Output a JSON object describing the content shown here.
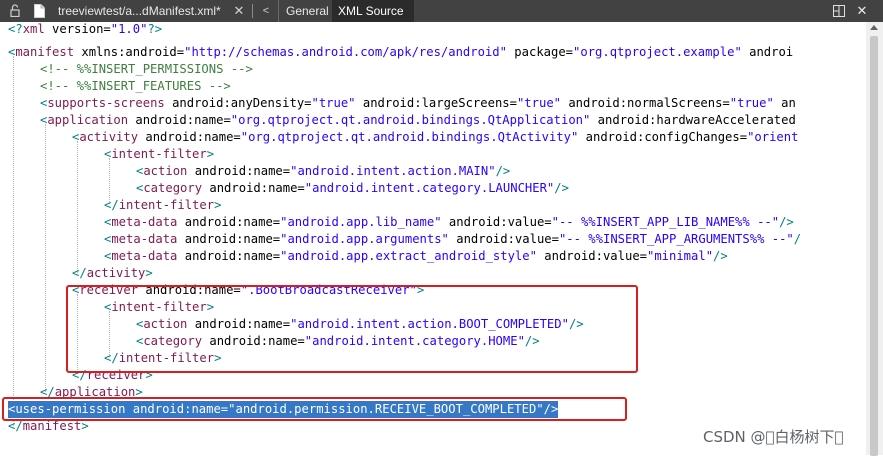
{
  "tabbar": {
    "file_tab": "treeviewtest/a...dManifest.xml*",
    "close_glyph": "✕",
    "nav_glyph": "<",
    "tabs": [
      "General",
      "XML Source"
    ],
    "active_tab": "XML Source",
    "close_editor_glyph": "✕",
    "icons": [
      "lock-icon",
      "file-icon",
      "split-editor-icon"
    ]
  },
  "colors": {
    "tabbar_bg": "#424242",
    "active_tab_bg": "#2b2b2b",
    "tag": "#7f1a4f",
    "bracket": "#008080",
    "value": "#2a00ff",
    "comment": "#3f7f3f",
    "selection": "#3478c6",
    "highlight_box": "#d81e1e"
  },
  "code": {
    "decl": {
      "open": "<?",
      "name": "xml",
      "attrs": " version=",
      "v": "\"1.0\"",
      "close": "?>"
    },
    "manifest": {
      "open": "<",
      "name": "manifest",
      "attrs": " xmlns:android=",
      "v1": "\"http://schemas.android.com/apk/res/android\"",
      "attrs2": " package=",
      "v2": "\"org.qtproject.example\"",
      "attrs3": " androi"
    },
    "comment_permissions": "<!-- %%INSERT_PERMISSIONS -->",
    "comment_features": "<!-- %%INSERT_FEATURES -->",
    "supports_screens": {
      "open": "<",
      "name": "supports-screens",
      "a1": " android:anyDensity=",
      "v1": "\"true\"",
      "a2": " android:largeScreens=",
      "v2": "\"true\"",
      "a3": " android:normalScreens=",
      "v3": "\"true\"",
      "a4": " an"
    },
    "application": {
      "open": "<",
      "name": "application",
      "a1": " android:name=",
      "v1": "\"org.qtproject.qt.android.bindings.QtApplication\"",
      "a2": " android:hardwareAccelerated"
    },
    "activity": {
      "open": "<",
      "name": "activity",
      "a1": " android:name=",
      "v1": "\"org.qtproject.qt.android.bindings.QtActivity\"",
      "a2": " android:configChanges=",
      "v2": "\"orient"
    },
    "intent_filter_open": {
      "open": "<",
      "name": "intent-filter",
      "close": ">"
    },
    "action_main": {
      "open": "<",
      "name": "action",
      "a1": " android:name=",
      "v1": "\"android.intent.action.MAIN\"",
      "close": "/>"
    },
    "category_launcher": {
      "open": "<",
      "name": "category",
      "a1": " android:name=",
      "v1": "\"android.intent.category.LAUNCHER\"",
      "close": "/>"
    },
    "intent_filter_close": {
      "open": "</",
      "name": "intent-filter",
      "close": ">"
    },
    "meta_lib": {
      "open": "<",
      "name": "meta-data",
      "a1": " android:name=",
      "v1": "\"android.app.lib_name\"",
      "a2": " android:value=",
      "v2": "\"-- %%INSERT_APP_LIB_NAME%% --\"",
      "close": "/>"
    },
    "meta_args": {
      "open": "<",
      "name": "meta-data",
      "a1": " android:name=",
      "v1": "\"android.app.arguments\"",
      "a2": " android:value=",
      "v2": "\"-- %%INSERT_APP_ARGUMENTS%% --\"",
      "close": "/"
    },
    "meta_style": {
      "open": "<",
      "name": "meta-data",
      "a1": " android:name=",
      "v1": "\"android.app.extract_android_style\"",
      "a2": " android:value=",
      "v2": "\"minimal\"",
      "close": "/>"
    },
    "activity_close": {
      "open": "</",
      "name": "activity",
      "close": ">"
    },
    "receiver": {
      "open": "<",
      "name": "receiver",
      "a1": " android:name=",
      "v1": "\".BootBroadcastReceiver\"",
      "close": ">"
    },
    "intent_filter_open2": {
      "open": "<",
      "name": "intent-filter",
      "close": ">"
    },
    "action_boot": {
      "open": "<",
      "name": "action",
      "a1": " android:name=",
      "v1": "\"android.intent.action.BOOT_COMPLETED\"",
      "close": "/>"
    },
    "category_home": {
      "open": "<",
      "name": "category",
      "a1": " android:name=",
      "v1": "\"android.intent.category.HOME\"",
      "close": "/>"
    },
    "intent_filter_close2": {
      "open": "</",
      "name": "intent-filter",
      "close": ">"
    },
    "receiver_close": {
      "open": "</",
      "name": "receiver",
      "close": ">"
    },
    "application_close": {
      "open": "</",
      "name": "application",
      "close": ">"
    },
    "uses_permission": {
      "open": "<",
      "name": "uses-permission",
      "a1": " android:name=",
      "v1": "\"android.permission.RECEIVE_BOOT_COMPLETED\"",
      "close": "/>"
    },
    "manifest_close": {
      "open": "</",
      "name": "manifest",
      "close": ">"
    }
  },
  "watermark": "CSDN @\u0000白杨树下\u0000"
}
